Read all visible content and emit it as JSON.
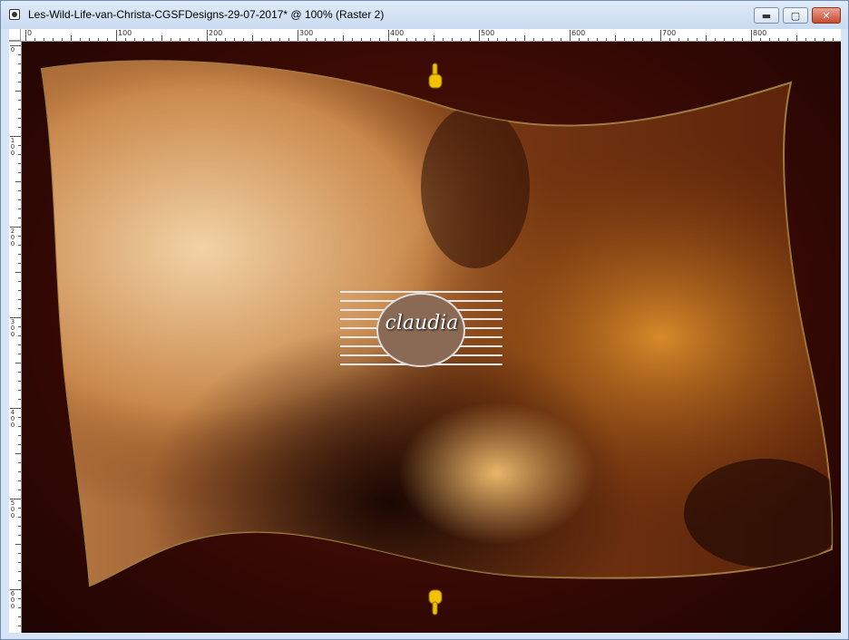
{
  "window": {
    "title": "Les-Wild-Life-van-Christa-CGSFDesigns-29-07-2017* @ 100% (Raster 2)",
    "controls": {
      "minimize": "▬",
      "maximize": "▢",
      "close": "✕"
    }
  },
  "ruler": {
    "top_labels": [
      "0",
      "100",
      "200",
      "300",
      "400",
      "500",
      "600",
      "700",
      "800"
    ],
    "left_labels": [
      "0",
      "1 0 0",
      "2 0 0",
      "3 0 0",
      "4 0 0",
      "5 0 0",
      "6 0 0"
    ]
  },
  "canvas": {
    "watermark_text": "claudia",
    "colors": {
      "background": "#3a0a04",
      "flag_light": "#e9c08a",
      "flag_dark": "#4a1d08",
      "hand": "#f2c200"
    }
  }
}
